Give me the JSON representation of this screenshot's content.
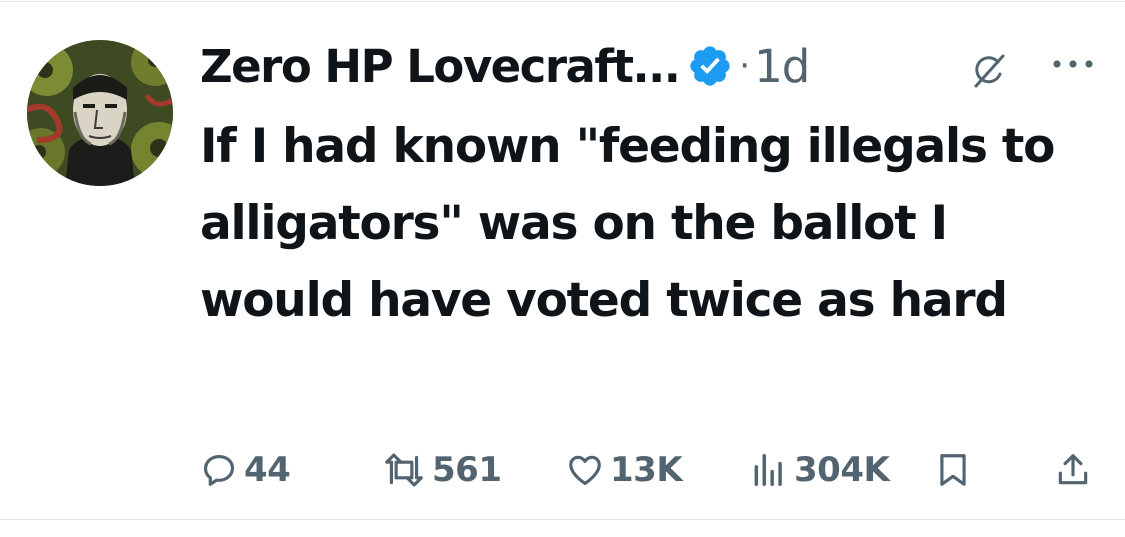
{
  "tweet": {
    "author": {
      "display_name": "Zero HP Lovecraft...",
      "verified": true,
      "avatar": "portrait-with-tentacles-avatar"
    },
    "separator": "·",
    "time": "1d",
    "text": "If I had known \"feeding illegals to alligators\" was on the ballot I would have voted twice as hard",
    "actions": {
      "reply_count": "44",
      "repost_count": "561",
      "like_count": "13K",
      "view_count": "304K"
    },
    "icons": {
      "verified": "verified-badge-icon",
      "grok": "grok-icon",
      "more": "more-options-icon",
      "reply": "reply-icon",
      "repost": "repost-icon",
      "like": "heart-icon",
      "views": "views-chart-icon",
      "bookmark": "bookmark-icon",
      "share": "share-icon"
    },
    "colors": {
      "text": "#0f1419",
      "secondary": "#536471",
      "verified": "#1d9bf0",
      "divider": "#e3e6e9"
    }
  }
}
